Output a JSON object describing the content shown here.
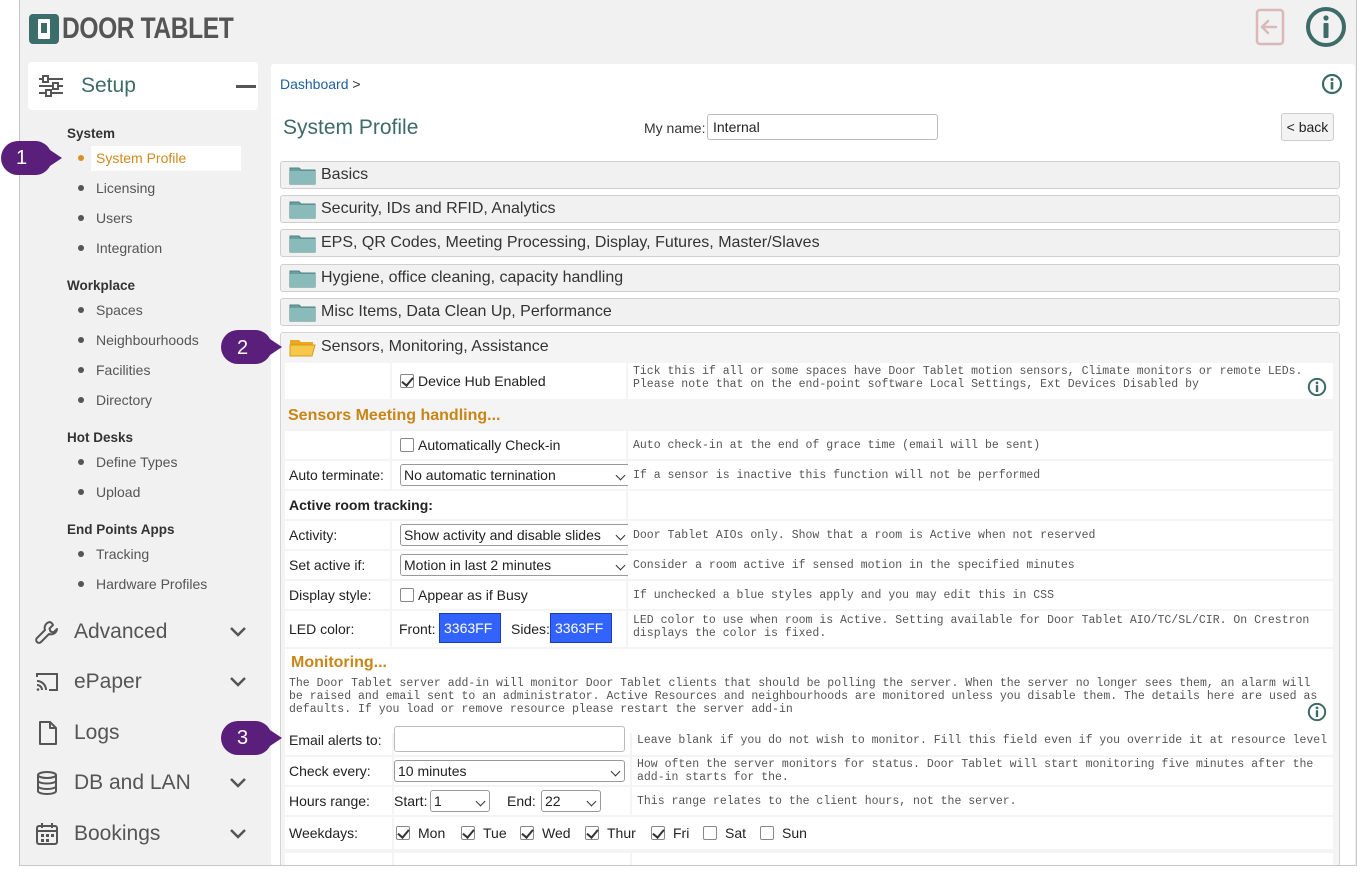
{
  "brand": {
    "name": "DOOR TABLET"
  },
  "sidebar": {
    "setup_label": "Setup",
    "groups": [
      {
        "title": "System",
        "items": [
          "System Profile",
          "Licensing",
          "Users",
          "Integration"
        ]
      },
      {
        "title": "Workplace",
        "items": [
          "Spaces",
          "Neighbourhoods",
          "Facilities",
          "Directory"
        ]
      },
      {
        "title": "Hot Desks",
        "items": [
          "Define Types",
          "Upload"
        ]
      },
      {
        "title": "End Points Apps",
        "items": [
          "Tracking",
          "Hardware Profiles"
        ]
      }
    ],
    "active_item": "System Profile",
    "menus": [
      "Advanced",
      "ePaper",
      "Logs",
      "DB and LAN",
      "Bookings"
    ]
  },
  "breadcrumb": {
    "link": "Dashboard",
    "sep": ">"
  },
  "page": {
    "title": "System Profile",
    "myname_label": "My name:",
    "myname_value": "Internal",
    "back_label": "< back"
  },
  "sections": [
    "Basics",
    "Security, IDs and RFID, Analytics",
    "EPS, QR Codes, Meeting Processing, Display, Futures, Master/Slaves",
    "Hygiene, office cleaning, capacity handling",
    "Misc Items, Data Clean Up, Performance",
    "Sensors, Monitoring, Assistance"
  ],
  "sensors": {
    "device_hub": {
      "label": "Device Hub Enabled",
      "checked": true,
      "desc": "Tick this if all or some spaces have Door Tablet motion sensors, Climate monitors or remote LEDs. Please note that on the end-point software Local Settings, Ext Devices Disabled by"
    },
    "meeting_heading": "Sensors Meeting handling...",
    "auto_checkin": {
      "label": "Automatically Check-in",
      "checked": false,
      "desc": "Auto check-in at the end of grace time (email will be sent)"
    },
    "auto_terminate": {
      "label": "Auto terminate:",
      "value": "No automatic ternination",
      "desc": "If a sensor is inactive this function will not be performed"
    },
    "active_tracking_heading": "Active room tracking:",
    "activity": {
      "label": "Activity:",
      "value": "Show activity and disable slides",
      "desc": "Door Tablet AIOs only. Show that a room is Active when not reserved"
    },
    "set_active": {
      "label": "Set active if:",
      "value": "Motion in last 2 minutes",
      "desc": "Consider a room active if sensed motion in the specified minutes"
    },
    "display_style": {
      "label": "Display style:",
      "option": "Appear as if Busy",
      "checked": false,
      "desc": "If unchecked a blue styles apply and you may edit this in CSS"
    },
    "led_color": {
      "label": "LED color:",
      "front_label": "Front:",
      "front_value": "3363FF",
      "sides_label": "Sides:",
      "sides_value": "3363FF",
      "desc": "LED color to use when room is Active. Setting available for Door Tablet AIO/TC/SL/CIR. On Crestron displays the color is fixed."
    },
    "monitoring_heading": "Monitoring...",
    "monitoring_desc": "The Door Tablet server add-in will monitor Door Tablet clients that should be polling the server. When the server no longer sees them, an alarm will be raised and email sent to an administrator. Active Resources and neighbourhoods are monitored unless you disable them. The details here are used as defaults.  If you load or remove resource please restart the server add-in",
    "email_alerts": {
      "label": "Email alerts to:",
      "value": "",
      "desc": "Leave blank if you do not wish to monitor. Fill this field even if you override it at resource level"
    },
    "check_every": {
      "label": "Check every:",
      "value": "10 minutes",
      "desc": "How often the server monitors for status. Door Tablet will start monitoring five minutes after the add-in starts for the."
    },
    "hours_range": {
      "label": "Hours range:",
      "start_label": "Start:",
      "start_value": "1",
      "end_label": "End:",
      "end_value": "22",
      "desc": "This range relates to the client hours, not the server."
    },
    "weekdays": {
      "label": "Weekdays:",
      "days": [
        {
          "name": "Mon",
          "checked": true
        },
        {
          "name": "Tue",
          "checked": true
        },
        {
          "name": "Wed",
          "checked": true
        },
        {
          "name": "Thur",
          "checked": true
        },
        {
          "name": "Fri",
          "checked": true
        },
        {
          "name": "Sat",
          "checked": false
        },
        {
          "name": "Sun",
          "checked": false
        }
      ]
    }
  },
  "callouts": [
    "1",
    "2",
    "3"
  ],
  "colors": {
    "accent": "#3d6b67",
    "active": "#d08a1e",
    "callout": "#5a1f7a",
    "led": "#3363ff"
  }
}
